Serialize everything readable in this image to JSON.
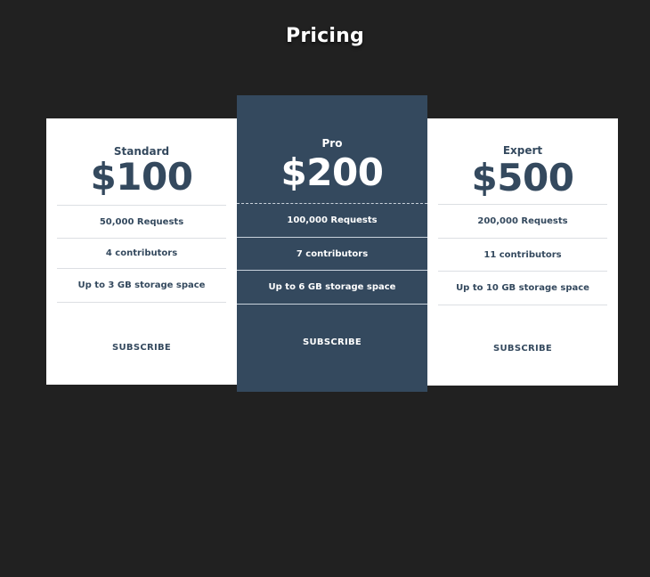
{
  "page": {
    "title": "Pricing"
  },
  "colors": {
    "background": "#212121",
    "accent": "#34495e",
    "card": "#ffffff"
  },
  "plans": [
    {
      "name": "Standard",
      "price": "$100",
      "features": [
        "50,000 Requests",
        "4 contributors",
        "Up to 3 GB storage space"
      ],
      "cta": "SUBSCRIBE",
      "featured": false
    },
    {
      "name": "Pro",
      "price": "$200",
      "features": [
        "100,000 Requests",
        "7 contributors",
        "Up to 6 GB storage space"
      ],
      "cta": "SUBSCRIBE",
      "featured": true
    },
    {
      "name": "Expert",
      "price": "$500",
      "features": [
        "200,000 Requests",
        "11 contributors",
        "Up to 10 GB storage space"
      ],
      "cta": "SUBSCRIBE",
      "featured": false
    }
  ]
}
